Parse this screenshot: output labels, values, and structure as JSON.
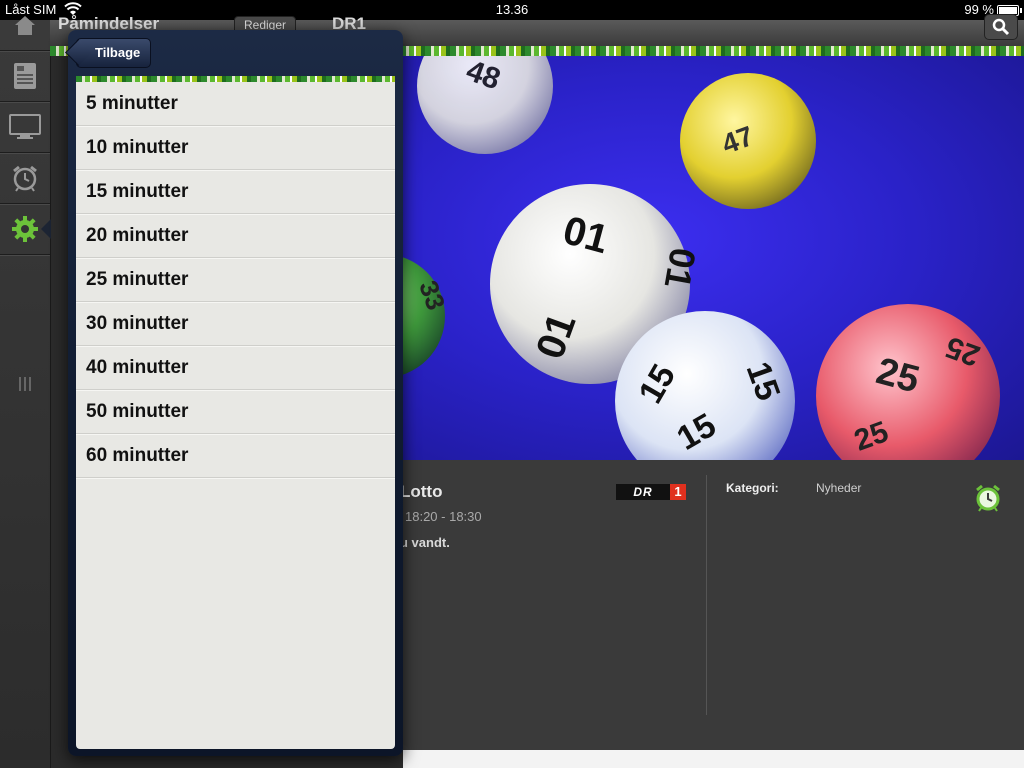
{
  "status_bar": {
    "carrier": "Låst SIM",
    "time": "13.36",
    "battery": "99 %"
  },
  "sidebar": {
    "items": [
      {
        "icon": "home-icon"
      },
      {
        "icon": "tv-guide-icon"
      },
      {
        "icon": "monitor-icon"
      },
      {
        "icon": "alarm-clock-icon"
      },
      {
        "icon": "gear-icon",
        "active": true
      }
    ]
  },
  "header": {
    "title": "Påmindelser",
    "edit_label": "Rediger",
    "channel": "DR1"
  },
  "program": {
    "title": "Lotto",
    "time": "18:20 - 18:30",
    "description": "u vandt.",
    "channel_logo_text": "DR",
    "channel_logo_number": "1",
    "category_label": "Kategori:",
    "category_value": "Nyheder"
  },
  "popover": {
    "back_label": "Tilbage",
    "options": [
      {
        "label": "5 minutter"
      },
      {
        "label": "10 minutter"
      },
      {
        "label": "15 minutter"
      },
      {
        "label": "20 minutter"
      },
      {
        "label": "25 minutter"
      },
      {
        "label": "30 minutter"
      },
      {
        "label": "40 minutter"
      },
      {
        "label": "50 minutter"
      },
      {
        "label": "60 minutter"
      }
    ]
  },
  "hero_balls": [
    {
      "number": "01",
      "color": "#f2f2ee"
    },
    {
      "number": "15",
      "color": "#e9eef8"
    },
    {
      "number": "25",
      "color": "#e85a6a"
    },
    {
      "number": "47",
      "color": "#e8d63a"
    },
    {
      "number": "33",
      "color": "#3f9a3c"
    },
    {
      "number": "48",
      "color": "#f2f2ee"
    }
  ],
  "colors": {
    "accent_green": "#6cc23a",
    "popover_navy": "#15213a",
    "hero_blue": "#2a22c8"
  }
}
